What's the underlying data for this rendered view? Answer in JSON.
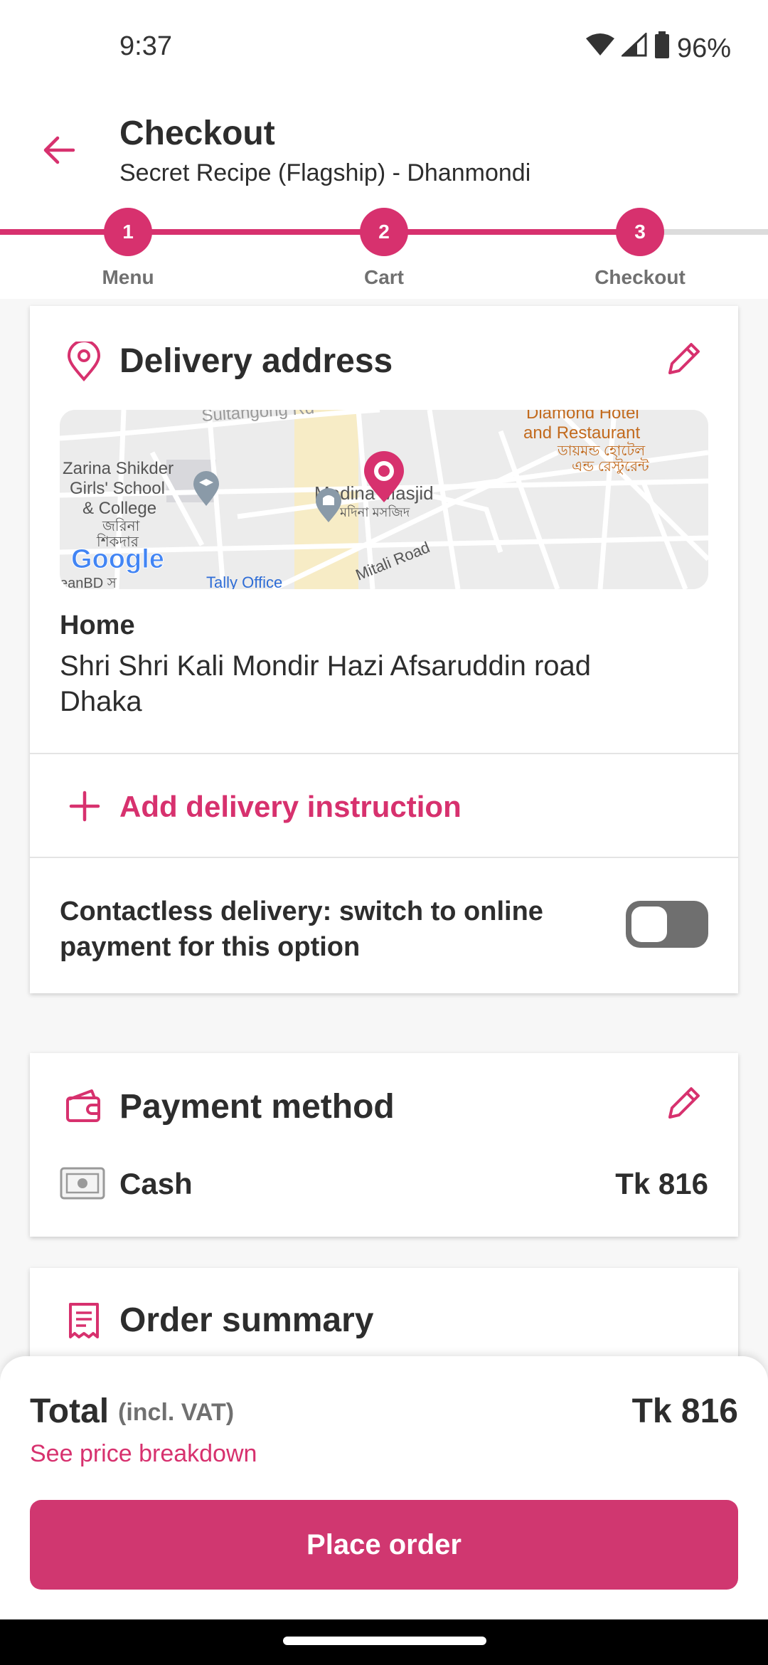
{
  "status_bar": {
    "time": "9:37",
    "battery": "96%"
  },
  "header": {
    "title": "Checkout",
    "subtitle": "Secret Recipe (Flagship) - Dhanmondi"
  },
  "stepper": {
    "steps": [
      {
        "number": "1",
        "label": "Menu"
      },
      {
        "number": "2",
        "label": "Cart"
      },
      {
        "number": "3",
        "label": "Checkout"
      }
    ]
  },
  "delivery": {
    "title": "Delivery address",
    "map_labels": {
      "road_top": "Sultangong Rd",
      "hotel_en": "Diamond Hotel",
      "hotel_en2": "and Restaurant",
      "hotel_bn": "ডায়মন্ড হোটেল",
      "hotel_bn2": "এন্ড রেস্টুরেন্ট",
      "school1": "Zarina Shikder",
      "school2": "Girls' School",
      "school3": "& College",
      "school_bn1": "জরিনা",
      "school_bn2": "শিকদার",
      "masjid": "Madina Masjid",
      "masjid_bn": "মদিনা মসজিদ",
      "road": "Mitali Road",
      "tally": "Tally Office",
      "clean": "eanBD স",
      "google": "Google"
    },
    "address_label": "Home",
    "address_line1": "Shri Shri Kali Mondir Hazi Afsaruddin road",
    "address_line2": "Dhaka",
    "add_instruction": "Add delivery instruction",
    "contactless_text": "Contactless delivery: switch to online payment for this option"
  },
  "payment": {
    "title": "Payment method",
    "method": "Cash",
    "amount": "Tk 816"
  },
  "order_summary": {
    "title": "Order summary"
  },
  "footer": {
    "total_label": "Total",
    "vat_note": "(incl. VAT)",
    "total_amount": "Tk 816",
    "breakdown_link": "See price breakdown",
    "place_order": "Place order"
  },
  "colors": {
    "accent": "#d7316e",
    "button": "#d03770"
  }
}
